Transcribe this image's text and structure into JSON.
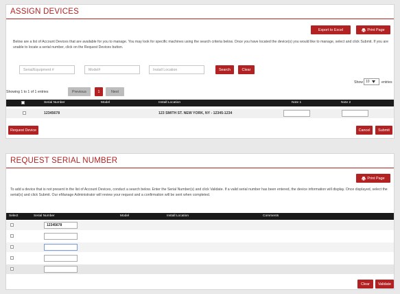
{
  "assign": {
    "title": "ASSIGN DEVICES",
    "export_label": "Export to Excel",
    "print_label": "Print Page",
    "description": "Below are a list of Account Devices that are available for you to manage. You may look for specific machines using the search criteria below. Once you have located the device(s) you would like to manage, select and click Submit. If you are unable to locate a serial number, click on the Request Devices button.",
    "filters": {
      "serial_placeholder": "Serial/Equipment #",
      "model_placeholder": "Model#",
      "location_placeholder": "Install Location",
      "search_label": "Search",
      "clear_label": "Clear"
    },
    "show_label": "Show",
    "show_value": "10",
    "entries_label": "entries",
    "showing_text": "Showing 1 to 1 of 1 entries",
    "pager": {
      "previous": "Previous",
      "page": "1",
      "next": "Next"
    },
    "columns": [
      "Serial Number",
      "Model",
      "Install Location",
      "Note 1",
      "Note 2"
    ],
    "rows": [
      {
        "serial": "12345678",
        "model": "",
        "location": "123 SMITH ST. NEW YORK, NY - 12345-1234",
        "note1": "",
        "note2": ""
      }
    ],
    "request_label": "Request Device",
    "cancel_label": "Cancel",
    "submit_label": "Submit"
  },
  "request": {
    "title": "REQUEST SERIAL NUMBER",
    "print_label": "Print Page",
    "description": "To add a device that is not present in the list of Account Devices, conduct a search below. Enter the Serial Number(s) and click Validate. If a valid serial number has been entered, the device information will display. Once displayed, select the serial(s) and click Submit. Our eManage Administrator will review your request and a confirmation will be sent when completed.",
    "columns": [
      "Select",
      "Serial Number",
      "Model",
      "Install Location",
      "Comments"
    ],
    "rows": [
      {
        "serial": "12345678"
      },
      {
        "serial": ""
      },
      {
        "serial": ""
      },
      {
        "serial": ""
      },
      {
        "serial": ""
      }
    ],
    "clear_label": "Clear",
    "validate_label": "Validate"
  },
  "colors": {
    "accent": "#b22222",
    "header": "#1a1a1a"
  },
  "icons": [
    "printer-icon",
    "chevron-down-icon"
  ]
}
